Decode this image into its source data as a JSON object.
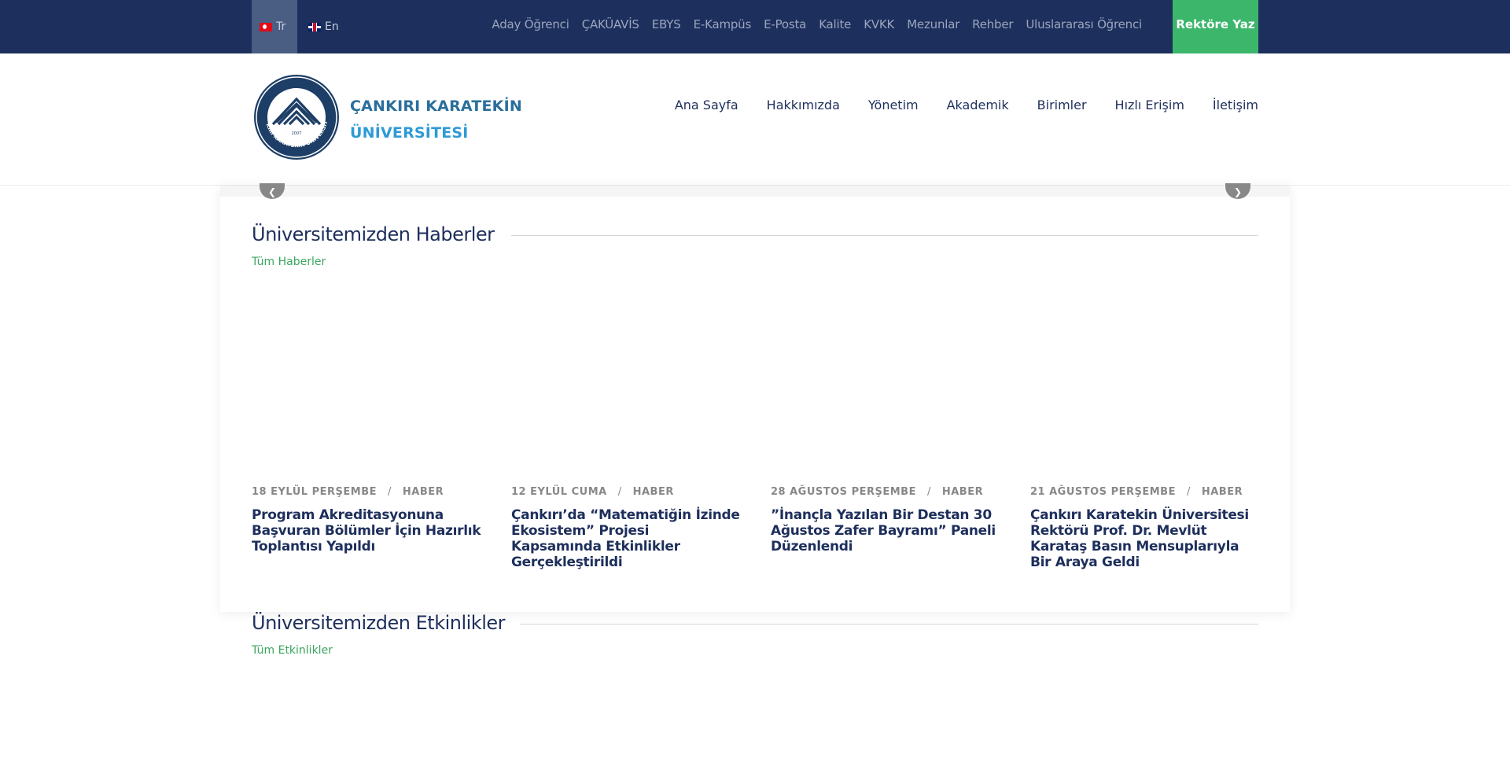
{
  "topbar": {
    "lang_tr": "Tr",
    "lang_en": "En",
    "links": [
      "Aday Öğrenci",
      "ÇAKÜAVİS",
      "EBYS",
      "E-Kampüs",
      "E-Posta",
      "Kalite",
      "KVKK",
      "Mezunlar",
      "Rehber",
      "Uluslararası Öğrenci"
    ],
    "cta": "Rektöre Yaz"
  },
  "header": {
    "brand_line1": "ÇANKIRI KARATEKİN",
    "brand_line2": "ÜNİVERSİTESİ",
    "nav": [
      "Ana Sayfa",
      "Hakkımızda",
      "Yönetim",
      "Akademik",
      "Birimler",
      "Hızlı Erişim",
      "İletişim"
    ]
  },
  "news_section": {
    "title": "Üniversitemizden Haberler",
    "link": "Tüm Haberler",
    "items": [
      {
        "date": "18 EYLÜL PERŞEMBE",
        "sep": "/",
        "category": "HABER",
        "title": "Program Akreditasyonuna Başvuran Bölümler İçin Hazırlık Toplantısı Yapıldı"
      },
      {
        "date": "12 EYLÜL CUMA",
        "sep": "/",
        "category": "HABER",
        "title": "Çankırı’da “Matematiğin İzinde Ekosistem” Projesi Kapsamında Etkinlikler Gerçekleştirildi"
      },
      {
        "date": "28 AĞUSTOS PERŞEMBE",
        "sep": "/",
        "category": "HABER",
        "title": "”İnançla Yazılan Bir Destan 30 Ağustos Zafer Bayramı” Paneli Düzenlendi"
      },
      {
        "date": "21 AĞUSTOS PERŞEMBE",
        "sep": "/",
        "category": "HABER",
        "title": "Çankırı Karatekin Üniversitesi Rektörü Prof. Dr. Mevlüt Karataş Basın Mensuplarıyla Bir Araya Geldi"
      }
    ]
  },
  "events_section": {
    "title": "Üniversitemizden Etkinlikler",
    "link": "Tüm Etkinlikler"
  },
  "colors": {
    "navy": "#1d2f5c",
    "green": "#3bb66b",
    "brand_blue": "#2e9ad6"
  }
}
